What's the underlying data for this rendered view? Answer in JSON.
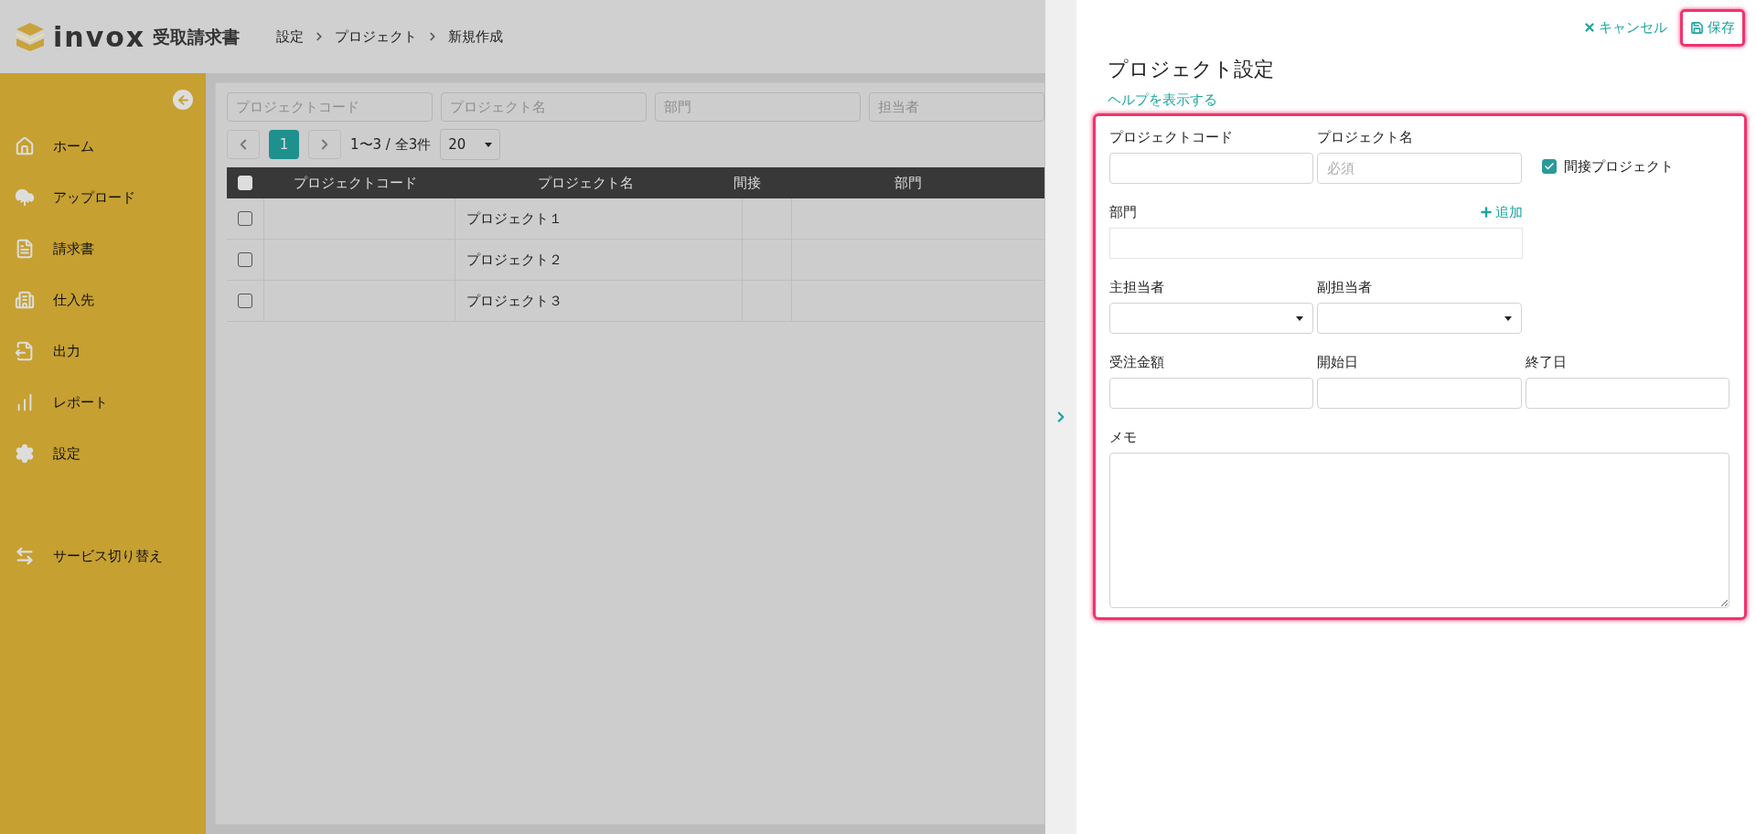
{
  "header": {
    "logo_text": "invox",
    "logo_subtext": "受取請求書",
    "breadcrumb": [
      "設定",
      "プロジェクト",
      "新規作成"
    ]
  },
  "sidebar": {
    "items": [
      {
        "label": "ホーム"
      },
      {
        "label": "アップロード"
      },
      {
        "label": "請求書"
      },
      {
        "label": "仕入先"
      },
      {
        "label": "出力"
      },
      {
        "label": "レポート"
      },
      {
        "label": "設定"
      }
    ],
    "footer_item": {
      "label": "サービス切り替え"
    }
  },
  "filters": [
    {
      "placeholder": "プロジェクトコード"
    },
    {
      "placeholder": "プロジェクト名"
    },
    {
      "placeholder": "部門"
    },
    {
      "placeholder": "担当者"
    }
  ],
  "pagination": {
    "pages": [
      {
        "label": "1",
        "selected": true
      }
    ],
    "range": "1〜3 / 全3件",
    "page_size": "20"
  },
  "table": {
    "select_all_checked": false,
    "columns": [
      "プロジェクトコード",
      "プロジェクト名",
      "間接",
      "部門"
    ],
    "rows": [
      {
        "checked": false,
        "name": "プロジェクト１"
      },
      {
        "checked": false,
        "name": "プロジェクト２"
      },
      {
        "checked": false,
        "name": "プロジェクト３"
      }
    ]
  },
  "panel": {
    "cancel": "キャンセル",
    "save": "保存",
    "title": "プロジェクト設定",
    "help_link": "ヘルプを表示する",
    "form": {
      "code_label": "プロジェクトコード",
      "name_label": "プロジェクト名",
      "name_placeholder": "必須",
      "indirect": {
        "label": "間接プロジェクト",
        "checked": true
      },
      "department_label": "部門",
      "add": "追加",
      "main_person_label": "主担当者",
      "sub_person_label": "副担当者",
      "amount_label": "受注金額",
      "start_label": "開始日",
      "end_label": "終了日",
      "memo_label": "メモ"
    }
  }
}
